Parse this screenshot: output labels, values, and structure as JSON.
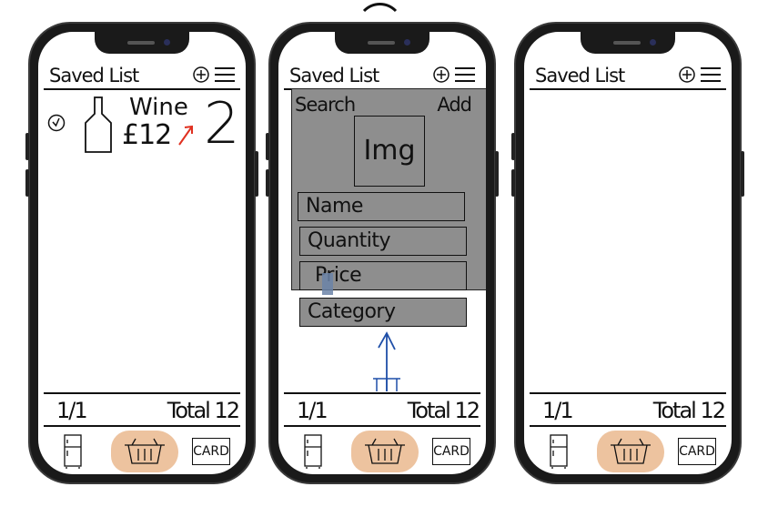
{
  "header": {
    "title": "Saved List"
  },
  "footer": {
    "page": "1/1",
    "total": "Total 12",
    "card_label": "CARD"
  },
  "icons": {
    "plus": "plus-circle-icon",
    "menu": "hamburger-menu-icon",
    "fridge": "fridge-icon",
    "basket": "basket-icon",
    "bottle": "bottle-icon",
    "check": "check-circle-icon"
  },
  "colors": {
    "basket_highlight": "#edc39f",
    "panel_gray": "#8e8e8e",
    "arrow_red": "#e03020",
    "arrow_blue": "#1f4fa8"
  },
  "screen1": {
    "item": {
      "name": "Wine",
      "price": "£12",
      "quantity": "2"
    }
  },
  "screen2": {
    "search_label": "Search",
    "add_label": "Add",
    "image_placeholder": "Img",
    "fields": {
      "name": "Name",
      "quantity": "Quantity",
      "price": "Price",
      "category": "Category"
    }
  }
}
